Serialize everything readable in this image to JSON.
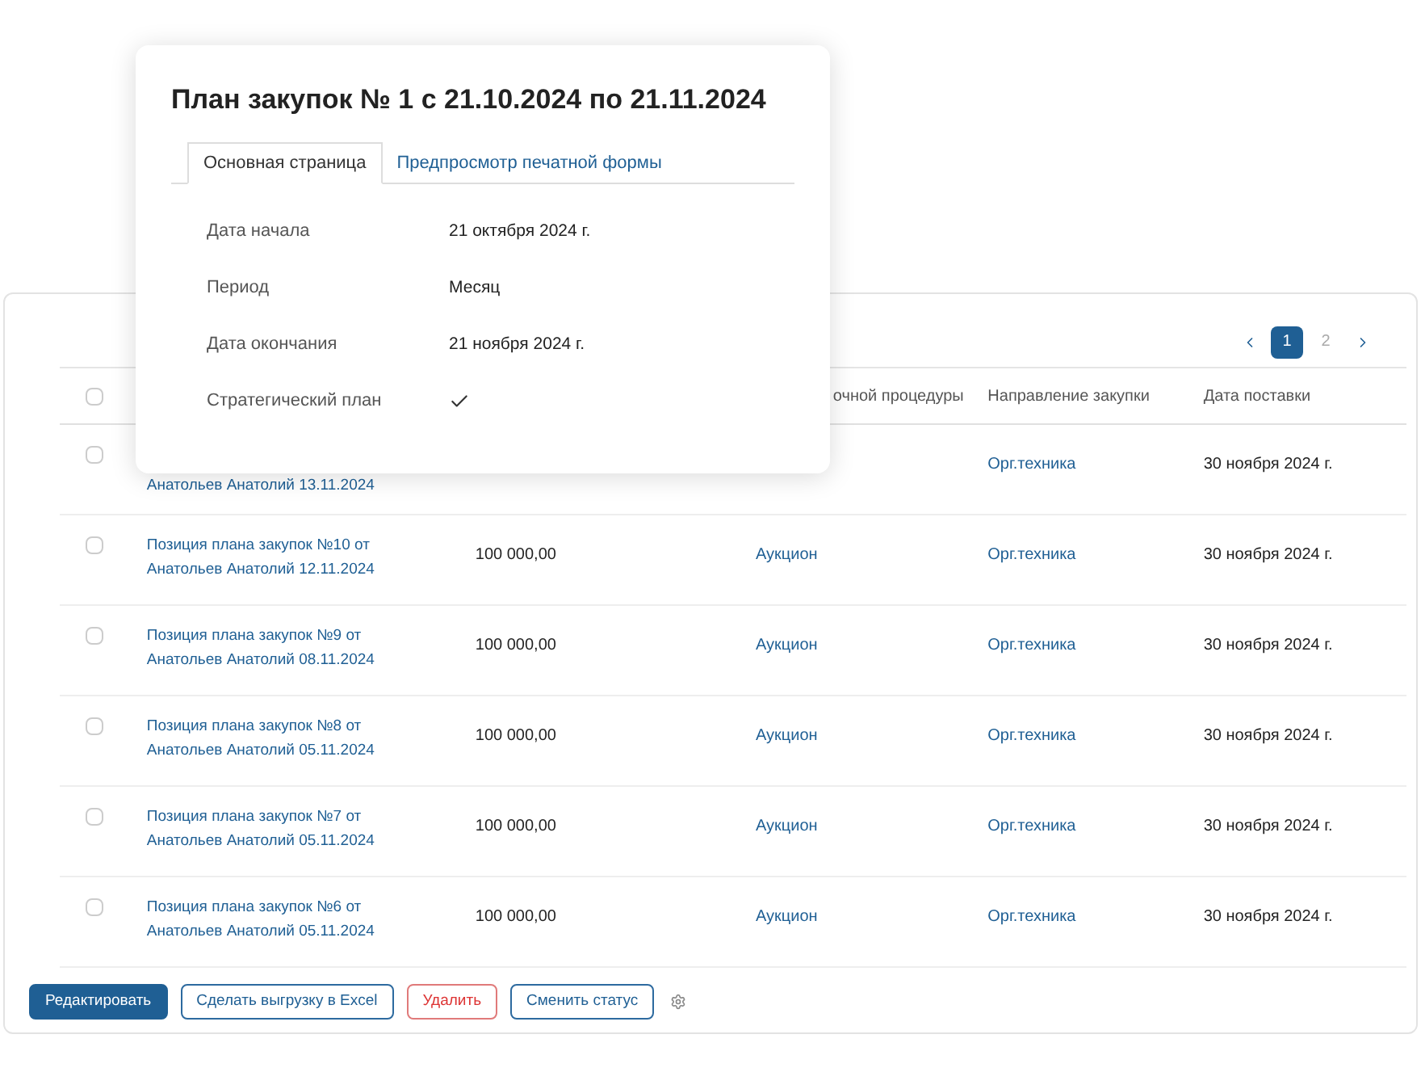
{
  "dialog": {
    "title": "План закупок № 1 с 21.10.2024 по 21.11.2024",
    "tabs": [
      {
        "label": "Основная страница",
        "selected": true
      },
      {
        "label": "Предпросмотр печатной формы",
        "selected": false
      }
    ],
    "fields": [
      {
        "label": "Дата начала",
        "kind": "text",
        "value": "21 октября 2024 г."
      },
      {
        "label": "Период",
        "kind": "text",
        "value": "Месяц"
      },
      {
        "label": "Дата окончания",
        "kind": "text",
        "value": "21 ноября 2024 г."
      },
      {
        "label": "Стратегический план",
        "kind": "check",
        "checked": true
      }
    ]
  },
  "pagination": {
    "pages": [
      {
        "label": "1",
        "selected": true
      },
      {
        "label": "2",
        "selected": false
      }
    ]
  },
  "table": {
    "header_checked": false,
    "columns": [
      {
        "label": "очной процедуры"
      },
      {
        "label": "Направление закупки"
      },
      {
        "label": "Дата поставки"
      }
    ],
    "rows": [
      {
        "checked": false,
        "kind": "covered",
        "name": "Анатольев Анатолий 13.11.2024",
        "amount": "",
        "procedure": "",
        "direction": "Орг.техника",
        "date": "30 ноября 2024 г."
      },
      {
        "checked": false,
        "kind": "full",
        "name": "Позиция плана закупок №10 от Анатольев Анатолий 12.11.2024",
        "amount": "100 000,00",
        "procedure": "Аукцион",
        "direction": "Орг.техника",
        "date": "30 ноября 2024 г."
      },
      {
        "checked": false,
        "kind": "full",
        "name": "Позиция плана закупок №9 от Анатольев Анатолий 08.11.2024",
        "amount": "100 000,00",
        "procedure": "Аукцион",
        "direction": "Орг.техника",
        "date": "30 ноября 2024 г."
      },
      {
        "checked": false,
        "kind": "full",
        "name": "Позиция плана закупок №8 от Анатольев Анатолий 05.11.2024",
        "amount": "100 000,00",
        "procedure": "Аукцион",
        "direction": "Орг.техника",
        "date": "30 ноября 2024 г."
      },
      {
        "checked": false,
        "kind": "full",
        "name": "Позиция плана закупок №7 от Анатольев Анатолий 05.11.2024",
        "amount": "100 000,00",
        "procedure": "Аукцион",
        "direction": "Орг.техника",
        "date": "30 ноября 2024 г."
      },
      {
        "checked": false,
        "kind": "full",
        "name": "Позиция плана закупок №6 от Анатольев Анатолий 05.11.2024",
        "amount": "100 000,00",
        "procedure": "Аукцион",
        "direction": "Орг.техника",
        "date": "30 ноября 2024 г."
      }
    ]
  },
  "actions": [
    {
      "label": "Редактировать",
      "kind": "primary"
    },
    {
      "label": "Сделать выгрузку в Excel",
      "kind": "outline"
    },
    {
      "label": "Удалить",
      "kind": "danger"
    },
    {
      "label": "Сменить статус",
      "kind": "outline"
    }
  ]
}
